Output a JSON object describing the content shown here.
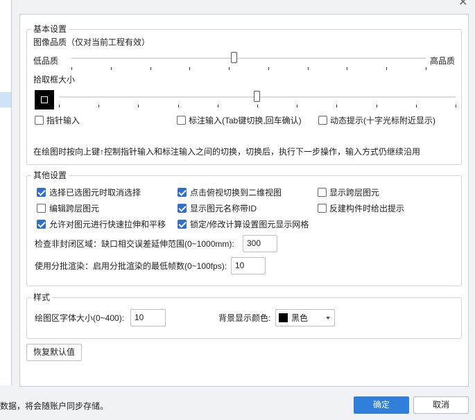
{
  "close_glyph": "✕",
  "basic": {
    "legend": "基本设置",
    "image_quality_label": "图像品质（仅对当前工程有效）",
    "low_quality": "低品质",
    "high_quality": "高品质",
    "image_quality_value": 0.46,
    "pick_box_label": "拾取框大小",
    "pick_box_value": 0.5,
    "pointer_input": {
      "label": "指针输入",
      "checked": false
    },
    "annotation_input": {
      "label": "标注输入(Tab键切换,回车确认)",
      "checked": false
    },
    "dynamic_hint": {
      "label": "动态提示(十字光标附近显示)",
      "checked": false
    },
    "note": "在绘图时按向上键↑控制指针输入和标注输入之间的切换，切换后，执行下一步操作，输入方式仍继续沿用"
  },
  "other": {
    "legend": "其他设置",
    "options": [
      {
        "label": "选择已选图元时取消选择",
        "checked": true
      },
      {
        "label": "点击俯视切换到二维视图",
        "checked": true
      },
      {
        "label": "显示跨层图元",
        "checked": false
      },
      {
        "label": "编辑跨层图元",
        "checked": false
      },
      {
        "label": "显示图元名称带ID",
        "checked": true
      },
      {
        "label": "反建构件时给出提示",
        "checked": false
      },
      {
        "label": "允许对图元进行快速拉伸和平移",
        "checked": true
      },
      {
        "label": "锁定/修改计算设置图元显示网格",
        "checked": true
      }
    ],
    "gap_label": "检查非封闭区域：缺口相交误差延伸范围(0~1000mm):",
    "gap_value": "300",
    "batch_label": "使用分批渲染：启用分批渲染的最低帧数(0~100fps):",
    "batch_value": "10"
  },
  "style": {
    "legend": "样式",
    "font_size_label": "绘图区字体大小(0~400):",
    "font_size_value": "10",
    "bg_color_label": "背景显示颜色:",
    "bg_color_value": "黑色",
    "bg_color_hex": "#000000"
  },
  "restore_button": "恢复默认值",
  "footer_text": "数据，将会随账户同步存储。",
  "ok_button": "确定",
  "cancel_button": "取消"
}
